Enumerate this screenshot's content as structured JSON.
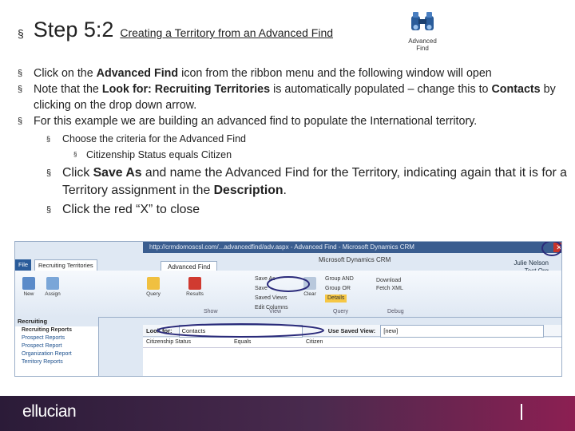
{
  "slide": {
    "bullet": "§",
    "step": "Step 5:2",
    "subtitle": "Creating a Territory from an Advanced Find",
    "adv_icon_label_1": "Advanced",
    "adv_icon_label_2": "Find"
  },
  "bullets": {
    "b1_pre": "Click on the ",
    "b1_bold": "Advanced Find",
    "b1_post": "  icon from the ribbon menu and the following window will open",
    "b2_pre": "Note that the ",
    "b2_bold": "Look for: Recruiting Territories",
    "b2_mid": " is automatically populated – change this to ",
    "b2_bold2": "Contacts",
    "b2_post": " by clicking on the drop down arrow.",
    "b3": "For this example we are building an advanced find to populate the International territory.",
    "b3_sub": "Choose the criteria for the Advanced Find",
    "b3_subsub": "Citizenship Status equals Citizen",
    "b4_pre": "Click ",
    "b4_bold": "Save As",
    "b4_mid": " and name the Advanced Find for the Territory, indicating again that it is for a Territory assignment in the ",
    "b4_bold2": "Description",
    "b4_post": ".",
    "b5": "Click the red “X” to close"
  },
  "screenshot": {
    "url": "http://crmdomoscsl.com/...advancedfind/adv.aspx - Advanced Find - Microsoft Dynamics CRM",
    "brand": "Microsoft Dynamics CRM",
    "user_name": "Julie Nelson",
    "user_org": "Test Org",
    "tab_file": "File",
    "tab_recruiting": "Recruiting Territories",
    "tab_adv": "Advanced Find",
    "btn_new": "New",
    "btn_assign": "Assign",
    "btn_query": "Query",
    "btn_results": "Results",
    "btn_clear": "Clear",
    "btn_group_and": "Group AND",
    "btn_group_or": "Group OR",
    "btn_details": "Details",
    "btn_save_as": "Save As",
    "btn_save": "Save",
    "btn_saved_views": "Saved Views",
    "btn_edit_columns": "Edit Columns",
    "btn_download": "Download Fetch XML",
    "grp_show": "Show",
    "grp_view": "View",
    "grp_query": "Query",
    "grp_debug": "Debug",
    "sidebar_title": "Recruiting",
    "sidebar_section": "Recruiting Reports",
    "sidebar_items": [
      "Prospect Reports",
      "Prospect Report",
      "Organization Report",
      "Territory Reports"
    ],
    "look_for_label": "Look for:",
    "look_for_value": "Contacts",
    "use_saved_view_label": "Use Saved View:",
    "use_saved_view_value": "[new]",
    "grid_col_1": "Citizenship Status",
    "grid_col_2": "Equals",
    "grid_col_3": "Citizen"
  },
  "footer": {
    "logo": "ellucian"
  },
  "colors": {
    "footer_start": "#2b1b38",
    "footer_end": "#8c1f52",
    "close_red": "#c8352a",
    "ribbon_blue": "#dfe8f3"
  }
}
